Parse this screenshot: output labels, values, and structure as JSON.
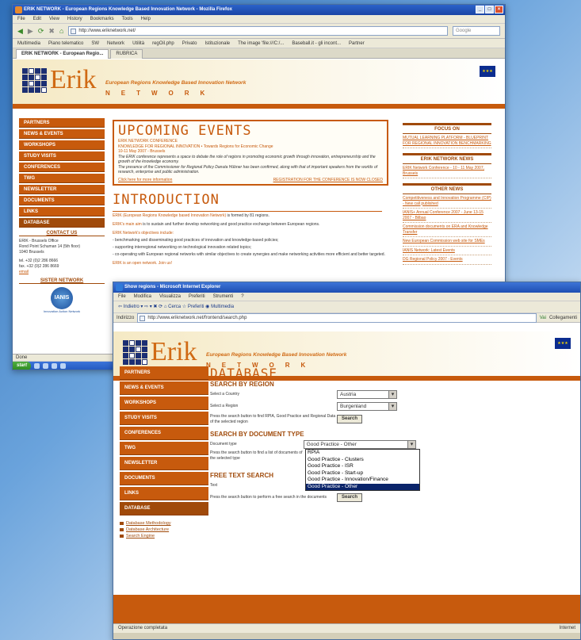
{
  "firefox": {
    "title": "ERIK NETWORK - European Regions Knowledge Based Innovation Network - Mozilla Firefox",
    "menu": [
      "File",
      "Edit",
      "View",
      "History",
      "Bookmarks",
      "Tools",
      "Help"
    ],
    "url": "http://www.eriknetwork.net/",
    "search_placeholder": "Google",
    "bookmarks": [
      "Multimedia",
      "Piano telematico",
      "SW",
      "Network",
      "Utilità",
      "regOil.php",
      "Privato",
      "Istituzionale",
      "The image 'file:///C:/...",
      "Baseball.it - gli incont...",
      "Partner"
    ],
    "tabs": [
      "ERIK NETWORK - European Regio...",
      "RUBRICA"
    ],
    "status": "Done",
    "taskbar": {
      "start": "start"
    }
  },
  "site": {
    "logo": "Erik",
    "tagline": "European Regions Knowledge Based Innovation Network",
    "network": "NETWORK",
    "menu": [
      "PARTNERS",
      "NEWS & EVENTS",
      "WORKSHOPS",
      "STUDY VISITS",
      "CONFERENCES",
      "TWG",
      "NEWSLETTER",
      "DOCUMENTS",
      "LINKS",
      "DATABASE"
    ],
    "contact_title": "CONTACT US",
    "contact": [
      "ERIK - Brussels Office",
      "Rond Point Schuman 14 (5th floor)",
      "1040 Brussels",
      "",
      "tel. +32 (0)2 286 8666",
      "fax. +32 (0)2 286 8669",
      "email"
    ],
    "sister_title": "SISTER NETWORK",
    "sister_logo": "IANIS",
    "sister_caption": "Innovation Action Network",
    "events": {
      "title": "UPCOMING EVENTS",
      "line1": "ERIK NETWORK CONFERENCE",
      "line2": "KNOWLEDGE FOR REGIONAL INNOVATION • Towards Regions for Economic Change",
      "line3": "10-11 May 2007 - Brussels",
      "body1": "The ERIK conference represents a space to debate the role of regions in promoting economic growth through innovation, entrepreneurship and the growth of the knowledge economy.",
      "body2": "The presence of the Commissioner for Regional Policy Danuta Hübner has been confirmed, along with that of important speakers from the worlds of research, enterprise and public administration.",
      "link": "Click here for more information",
      "closed": "REGISTRATION FOR THE CONFERENCE IS NOW CLOSED"
    },
    "intro": {
      "title": "INTRODUCTION",
      "p1a": "ERIK (European Regions Knowledge based Innovation Network)",
      "p1b": " is formed by 81 regions.",
      "p2a": "ERIK's main aim",
      "p2b": " is to sustain and further develop networking and good practice exchange between European regions.",
      "p3": "ERIK Network's objectives include:",
      "b1": "- benchmarking and disseminating good practices of innovation and knowledge-based policies;",
      "b2": "- supporting interregional networking on technological innovation related topics;",
      "b3": "- co-operating with European regional networks with similar objectives to create synergies and make networking activities more efficient and better targeted.",
      "p4": "ERIK is an open network. Join us!"
    },
    "focus_title": "FOCUS ON",
    "focus": [
      "MUTUAL LEARNING PLATFORM - BLUEPRINT FOR REGIONAL INNOVATION BENCHMARKING"
    ],
    "erik_news_title": "ERIK NETWORK NEWS",
    "erik_news": [
      "ERIK Network Conference - 10 - 11 May 2007, Brussels"
    ],
    "other_news_title": "OTHER NEWS",
    "other_news": [
      "Competitiveness and Innovation Programme (CIP) - New call published",
      "IANIS+ Annual Conference 2007 - June 13-15 2007 - Bilbao",
      "Commission documents on ERA and Knowledge Transfer",
      "New European Commission web site for SMEs",
      "IANIS Network: Latest Events",
      "DG Regional Policy 2007 - Events"
    ]
  },
  "ie": {
    "title": "Show regions - Microsoft Internet Explorer",
    "menu": [
      "File",
      "Modifica",
      "Visualizza",
      "Preferiti",
      "Strumenti",
      "?"
    ],
    "toolbar": "⇦ Indietro ▾ ⇨ ▾  ✖  ⟳  ⌂   Cerca   ☆ Preferiti   ◉ Multimedia",
    "address_label": "Indirizzo",
    "url": "http://www.eriknetwork.net/frontend/search.php",
    "go": "Vai",
    "links": "Collegamenti",
    "status": "Operazione completata",
    "zone": "Internet",
    "db_title": "DATABASE",
    "by_region": "SEARCH BY REGION",
    "country_label": "Select a Country",
    "country_value": "Austria",
    "region_label": "Select a Region",
    "region_value": "Burgenland",
    "region_help": "Press the search button to find RPIA, Good Practice and Regional Data of the selected region",
    "search_btn": "Search",
    "by_doc": "SEARCH BY DOCUMENT TYPE",
    "doc_label": "Document type",
    "doc_value": "Good Practice - Other",
    "doc_help": "Press the search button to find a list of documents of the selected type",
    "doc_options": [
      "RPIA",
      "Good Practice - Clusters",
      "Good Practice - ISR",
      "Good Practice - Start-up",
      "Good Practice - Innovation/Finance",
      "Good Practice - Other"
    ],
    "free_title": "FREE TEXT SEARCH",
    "text_label": "Text",
    "free_help": "Press the search button to perform a free search in the documents",
    "sublinks": [
      "Database Methodology",
      "Database Architecture",
      "Search Engine"
    ]
  }
}
